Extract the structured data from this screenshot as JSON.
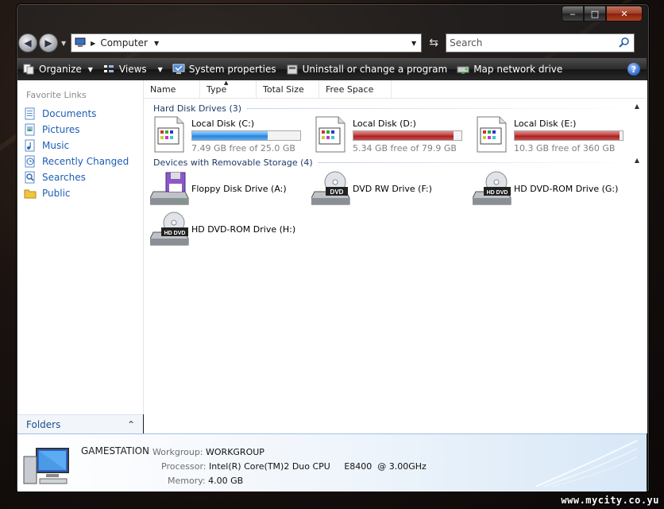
{
  "window": {
    "caption_min": "‒",
    "caption_max": "□",
    "caption_close": "✕"
  },
  "address": {
    "location": "Computer",
    "search_placeholder": "Search"
  },
  "toolbar": {
    "organize": "Organize",
    "views": "Views",
    "system_properties": "System properties",
    "uninstall": "Uninstall or change a program",
    "map_network": "Map network drive",
    "help": "?"
  },
  "sidebar": {
    "title": "Favorite Links",
    "items": [
      {
        "label": "Documents",
        "icon": "documents-icon"
      },
      {
        "label": "Pictures",
        "icon": "pictures-icon"
      },
      {
        "label": "Music",
        "icon": "music-icon"
      },
      {
        "label": "Recently Changed",
        "icon": "recently-changed-icon"
      },
      {
        "label": "Searches",
        "icon": "searches-icon"
      },
      {
        "label": "Public",
        "icon": "public-folder-icon"
      }
    ],
    "folders_label": "Folders"
  },
  "columns": [
    "Name",
    "Type",
    "Total Size",
    "Free Space"
  ],
  "groups": {
    "hard_disks": "Hard Disk Drives (3)",
    "removable": "Devices with Removable Storage (4)"
  },
  "hard_drives": [
    {
      "name": "Local Disk (C:)",
      "free": "7.49 GB free of 25.0 GB",
      "used_fraction": 0.7,
      "bar_color": "#2382d8"
    },
    {
      "name": "Local Disk (D:)",
      "free": "5.34 GB free of 79.9 GB",
      "used_fraction": 0.93,
      "bar_color": "#a81e1e"
    },
    {
      "name": "Local Disk (E:)",
      "free": "10.3 GB free of 360 GB",
      "used_fraction": 0.97,
      "bar_color": "#a81e1e"
    }
  ],
  "removable": [
    {
      "name": "Floppy Disk Drive (A:)",
      "icon": "floppy-drive-icon",
      "badge": ""
    },
    {
      "name": "DVD RW Drive (F:)",
      "icon": "dvd-rw-drive-icon",
      "badge": "DVD"
    },
    {
      "name": "HD DVD-ROM Drive (G:)",
      "icon": "hd-dvd-drive-icon",
      "badge": "HD DVD"
    },
    {
      "name": "HD DVD-ROM Drive (H:)",
      "icon": "hd-dvd-drive-icon",
      "badge": "HD DVD"
    }
  ],
  "details": {
    "computer_name": "GAMESTATION",
    "workgroup_label": "Workgroup:",
    "workgroup": "WORKGROUP",
    "processor_label": "Processor:",
    "processor": "Intel(R) Core(TM)2 Duo CPU     E8400  @ 3.00GHz",
    "memory_label": "Memory:",
    "memory": "4.00 GB"
  },
  "watermark": "www.mycity.co.yu"
}
